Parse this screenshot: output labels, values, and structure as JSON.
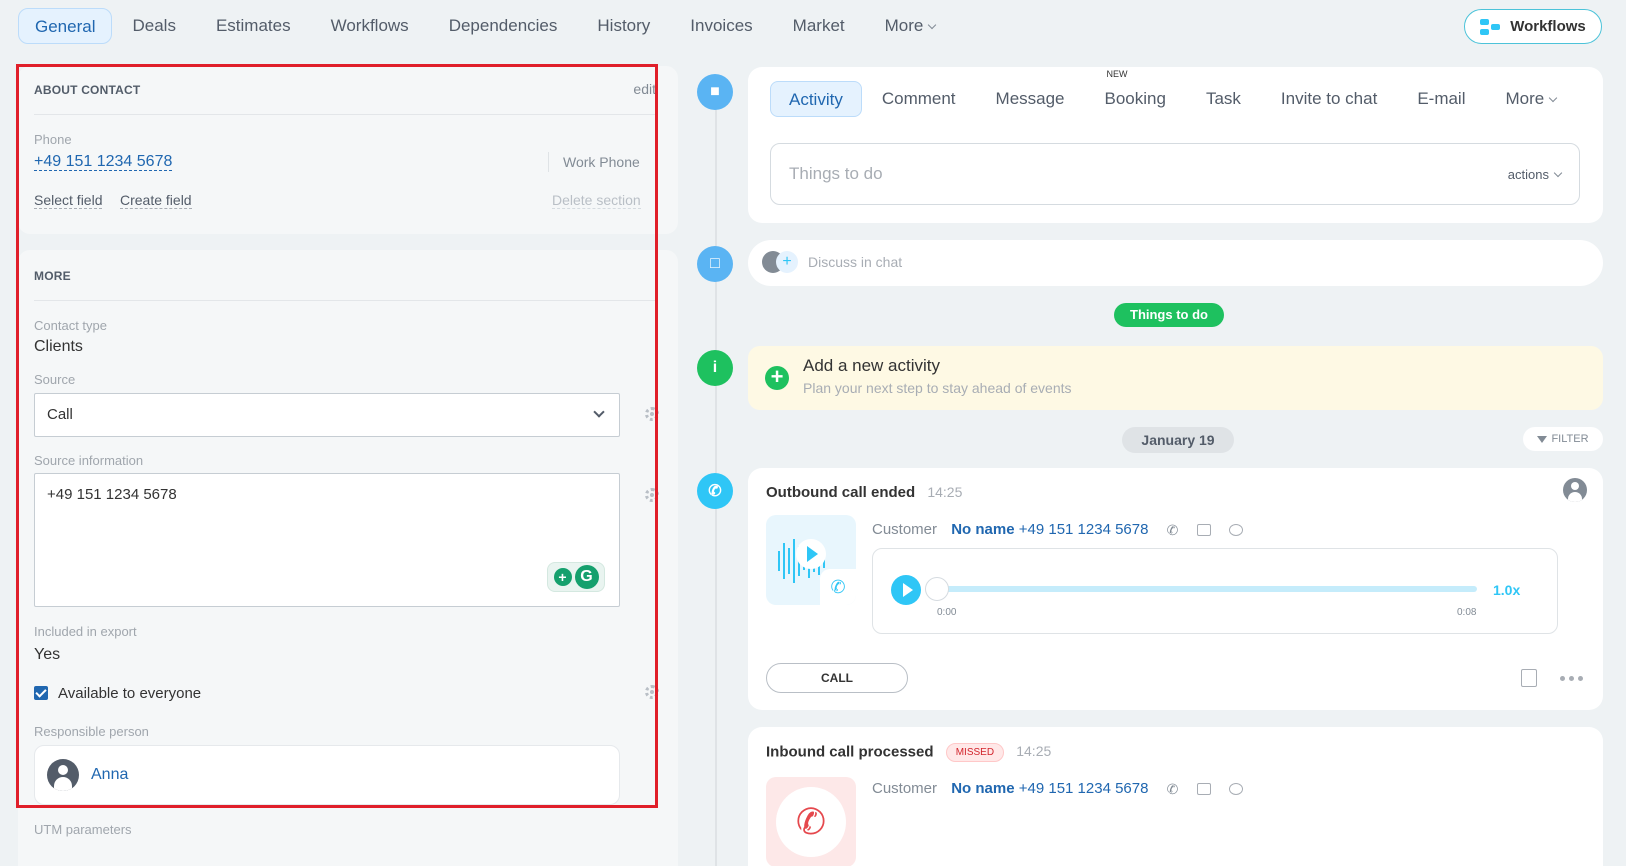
{
  "top_tabs": [
    "General",
    "Deals",
    "Estimates",
    "Workflows",
    "Dependencies",
    "History",
    "Invoices",
    "Market",
    "More"
  ],
  "workflows_button": "Workflows",
  "about": {
    "title": "ABOUT CONTACT",
    "edit": "edit",
    "phone_label": "Phone",
    "phone_value": "+49 151 1234 5678",
    "phone_type": "Work Phone",
    "select_field": "Select field",
    "create_field": "Create field",
    "delete_section": "Delete section"
  },
  "more": {
    "title": "MORE",
    "contact_type_label": "Contact type",
    "contact_type_value": "Clients",
    "source_label": "Source",
    "source_value": "Call",
    "source_info_label": "Source information",
    "source_info_value": "+49 151 1234 5678",
    "export_label": "Included in export",
    "export_value": "Yes",
    "available_label": "Available to everyone",
    "available_checked": true,
    "responsible_label": "Responsible person",
    "responsible_name": "Anna",
    "utm_label": "UTM parameters"
  },
  "activity_tabs": [
    "Activity",
    "Comment",
    "Message",
    "Booking",
    "Task",
    "Invite to chat",
    "E-mail",
    "More"
  ],
  "booking_badge": "NEW",
  "todo_placeholder": "Things to do",
  "todo_actions": "actions",
  "discuss_chat": "Discuss in chat",
  "things_pill": "Things to do",
  "add_activity": {
    "title": "Add a new activity",
    "subtitle": "Plan your next step to stay ahead of events"
  },
  "date_pill": "January 19",
  "filter_label": "FILTER",
  "outbound": {
    "title": "Outbound call ended",
    "time": "14:25",
    "customer_label": "Customer",
    "customer_name": "No name",
    "customer_phone": "+49 151 1234 5678",
    "player_start": "0:00",
    "player_end": "0:08",
    "speed": "1.0x",
    "call_button": "CALL",
    "progress": 0
  },
  "inbound": {
    "title": "Inbound call processed",
    "badge": "MISSED",
    "time": "14:25",
    "customer_label": "Customer",
    "customer_name": "No name",
    "customer_phone": "+49 151 1234 5678"
  },
  "colors": {
    "accent": "#2067b0",
    "green": "#1ec15f",
    "cyan": "#2fc6f6",
    "highlight": "#e01f2a"
  }
}
